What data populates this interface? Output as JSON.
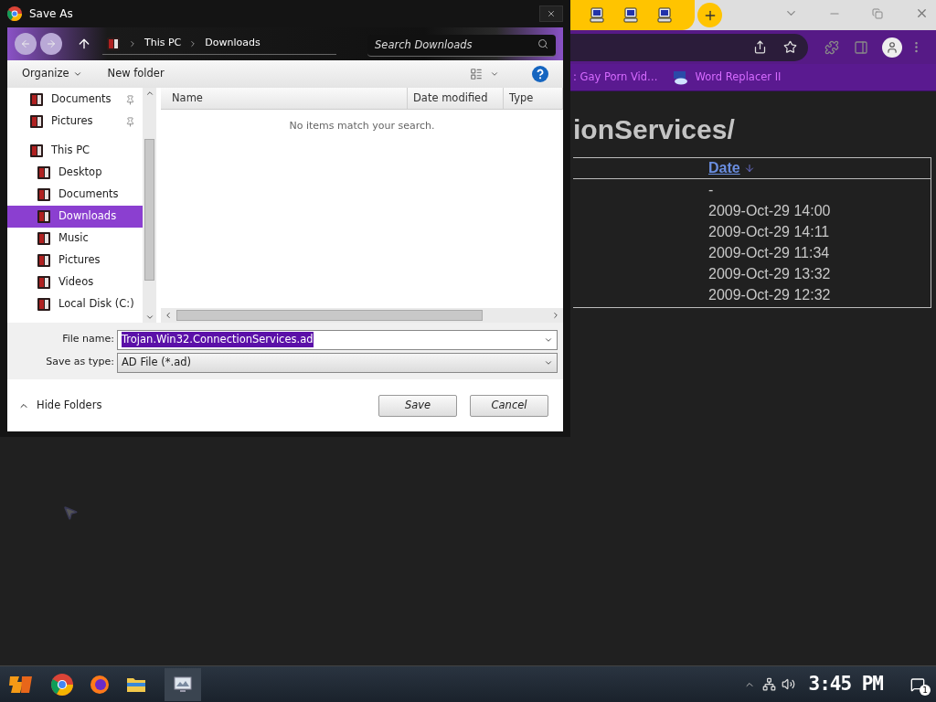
{
  "dialog": {
    "title": "Save As",
    "breadcrumb": [
      "This PC",
      "Downloads"
    ],
    "search": {
      "placeholder": "Search Downloads"
    },
    "toolbar": {
      "organize": "Organize",
      "new_folder": "New folder"
    },
    "nav": [
      {
        "label": "Documents",
        "pinned": true,
        "selected": false
      },
      {
        "label": "Pictures",
        "pinned": true,
        "selected": false
      },
      {
        "label": "This PC",
        "selected": false,
        "children": [
          {
            "label": "Desktop",
            "selected": false
          },
          {
            "label": "Documents",
            "selected": false
          },
          {
            "label": "Downloads",
            "selected": true
          },
          {
            "label": "Music",
            "selected": false
          },
          {
            "label": "Pictures",
            "selected": false
          },
          {
            "label": "Videos",
            "selected": false
          },
          {
            "label": "Local Disk (C:)",
            "selected": false
          }
        ]
      }
    ],
    "columns": [
      "Name",
      "Date modified",
      "Type"
    ],
    "empty_message": "No items match your search.",
    "file_name": {
      "label": "File name:",
      "value": "Trojan.Win32.ConnectionServices.ad",
      "text_selected": true
    },
    "save_type": {
      "label": "Save as type:",
      "value": "AD File (*.ad)"
    },
    "hide_folders": "Hide Folders",
    "buttons": [
      "Save",
      "Cancel"
    ]
  },
  "browser": {
    "bookmarks": [
      {
        "label": ": Gay Porn Vid…"
      },
      {
        "label": "Word Replacer II"
      }
    ],
    "heading": "ionServices/",
    "table": {
      "columns": [
        "Date"
      ],
      "rows": [
        "-",
        "2009-Oct-29 14:00",
        "2009-Oct-29 14:11",
        "2009-Oct-29 11:34",
        "2009-Oct-29 13:32",
        "2009-Oct-29 12:32"
      ]
    }
  },
  "taskbar": {
    "clock": "3:45 PM",
    "notification_count": "1"
  }
}
